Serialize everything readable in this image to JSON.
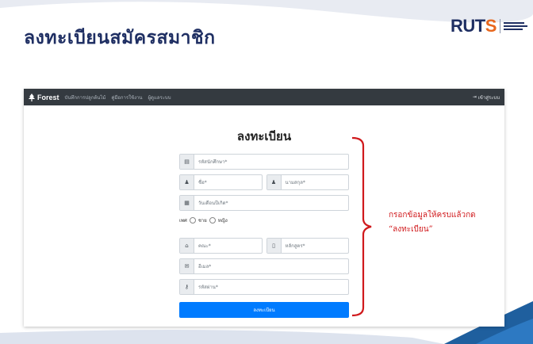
{
  "slide": {
    "title": "ลงทะเบียนสมัครสมาชิก",
    "logo_text_a": "RUT",
    "logo_text_b": "S"
  },
  "navbar": {
    "brand": "Forest",
    "links": [
      "บันทึกการปลูกต้นไม้",
      "คู่มือการใช้งาน",
      "ผู้ดูแลระบบ"
    ],
    "login": "เข้าสู่ระบบ"
  },
  "form": {
    "title": "ลงทะเบียน",
    "student_id_placeholder": "รหัสนักศึกษา*",
    "first_name_placeholder": "ชื่อ*",
    "last_name_placeholder": "นามสกุล*",
    "birthdate_placeholder": "วันเดือนปีเกิด*",
    "gender_label": "เพศ",
    "gender_male": "ชาย",
    "gender_female": "หญิง",
    "faculty_placeholder": "คณะ*",
    "program_placeholder": "หลักสูตร*",
    "email_placeholder": "อีเมล*",
    "password_placeholder": "รหัสผ่าน*",
    "submit_label": "ลงทะเบียน"
  },
  "annotation": {
    "line1": "กรอกข้อมูลให้ครบแล้วกด",
    "line2": "“ลงทะเบียน”",
    "color": "#d0191c"
  },
  "colors": {
    "title": "#1f2f63",
    "navbar": "#343a40",
    "primary": "#007bff",
    "accent": "#e8671d"
  },
  "icons": [
    "tree-icon",
    "login-icon",
    "id-card-icon",
    "user-icon",
    "calendar-icon",
    "bank-icon",
    "book-icon",
    "envelope-icon",
    "key-icon"
  ]
}
